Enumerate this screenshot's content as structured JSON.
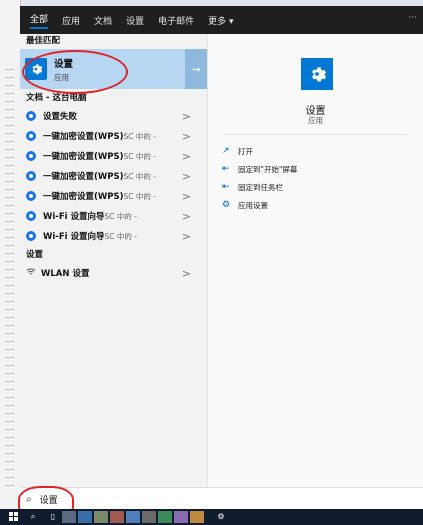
{
  "tabs": [
    "全部",
    "应用",
    "文档",
    "设置",
    "电子邮件",
    "更多 ▾"
  ],
  "tabs_more_dots": "···",
  "best_match": {
    "section": "最佳匹配",
    "title": "设置",
    "subtitle": "应用",
    "arrow": "→"
  },
  "docs_section": "文档 - 这台电脑",
  "doc_items": [
    {
      "label": "设置失败",
      "suffix": ""
    },
    {
      "label": "一键加密设置(WPS)",
      "suffix": "SC 中的 -"
    },
    {
      "label": "一键加密设置(WPS)",
      "suffix": "SC 中的 -"
    },
    {
      "label": "一键加密设置(WPS)",
      "suffix": "SC 中的 -"
    },
    {
      "label": "一键加密设置(WPS)",
      "suffix": "SC 中的 -"
    },
    {
      "label": "Wi-Fi 设置向导",
      "suffix": "SC 中的 -"
    },
    {
      "label": "Wi-Fi 设置向导",
      "suffix": "SC 中的 -"
    }
  ],
  "settings_section": "设置",
  "settings_items": [
    {
      "label": "WLAN 设置"
    }
  ],
  "chevron": ">",
  "detail": {
    "title": "设置",
    "subtitle": "应用",
    "actions": [
      {
        "icon": "open-icon",
        "glyph": "↗",
        "label": "打开"
      },
      {
        "icon": "pin-icon",
        "glyph": "⇤",
        "label": "固定到\"开始\"屏幕"
      },
      {
        "icon": "pin-taskbar-icon",
        "glyph": "⇤",
        "label": "固定到任务栏"
      },
      {
        "icon": "gear-icon",
        "glyph": "⚙",
        "label": "应用设置"
      }
    ]
  },
  "search": {
    "icon": "⌕",
    "value": "设置"
  },
  "colors": {
    "accent": "#0078d4",
    "selected": "#b7d6f2",
    "annotation": "#e0252a"
  }
}
